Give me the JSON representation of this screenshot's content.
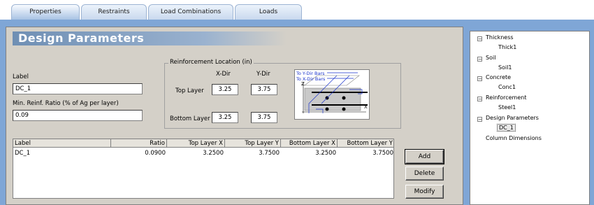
{
  "tabs": [
    {
      "label": "Properties"
    },
    {
      "label": "Restraints"
    },
    {
      "label": "Load Combinations"
    },
    {
      "label": "Loads"
    }
  ],
  "panel": {
    "title": "Design Parameters",
    "label_caption": "Label",
    "label_value": "DC_1",
    "min_ratio_caption": "Min. Reinf. Ratio (% of Ag per layer)",
    "min_ratio_value": "0.09"
  },
  "reinforcement": {
    "group_title": "Reinforcement Location (in)",
    "xdir_header": "X-Dir",
    "ydir_header": "Y-Dir",
    "top_layer_label": "Top Layer",
    "bottom_layer_label": "Bottom Layer",
    "top_x": "3.25",
    "top_y": "3.75",
    "bottom_x": "3.25",
    "bottom_y": "3.75",
    "diagram": {
      "to_y_dir_bars": "To Y-Dir Bars",
      "to_x_dir_bars": "To X-Dir Bars",
      "z_axis": "Z",
      "x_axis": "X"
    }
  },
  "table": {
    "columns": [
      "Label",
      "Ratio",
      "Top Layer X",
      "Top Layer Y",
      "Bottom Layer X",
      "Bottom Layer Y"
    ],
    "rows": [
      [
        "DC_1",
        "0.0900",
        "3.2500",
        "3.7500",
        "3.2500",
        "3.7500"
      ]
    ]
  },
  "buttons": {
    "add": "Add",
    "delete": "Delete",
    "modify": "Modify"
  },
  "tree": {
    "thickness": "Thickness",
    "thick1": "Thick1",
    "soil": "Soil",
    "soil1": "Soil1",
    "concrete": "Concrete",
    "conc1": "Conc1",
    "reinforcement": "Reinforcement",
    "steel1": "Steel1",
    "design_parameters": "Design Parameters",
    "dc_1": "DC_1",
    "column_dimensions": "Column Dimensions",
    "expanded_symbol": "−"
  },
  "colors": {
    "frame_blue": "#7fa6d6",
    "dialog_gray": "#d4d0c8",
    "diagram_blue": "#1a33cc"
  }
}
